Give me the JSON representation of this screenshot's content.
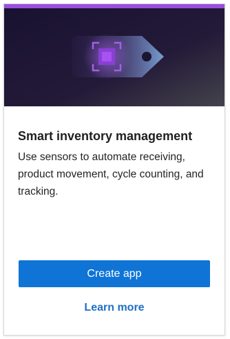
{
  "card": {
    "title": "Smart inventory management",
    "description": "Use sensors to automate receiving, product movement, cycle counting, and tracking.",
    "primary_action_label": "Create app",
    "secondary_action_label": "Learn more"
  },
  "hero": {
    "illustration_icon": "tag-with-scan-frame-icon"
  },
  "colors": {
    "accent_bar": "#9b4fde",
    "hero_background_start": "#1a1230",
    "hero_background_end": "#3b3a45",
    "primary_button": "#0f74d6",
    "link": "#1f6fc3"
  }
}
